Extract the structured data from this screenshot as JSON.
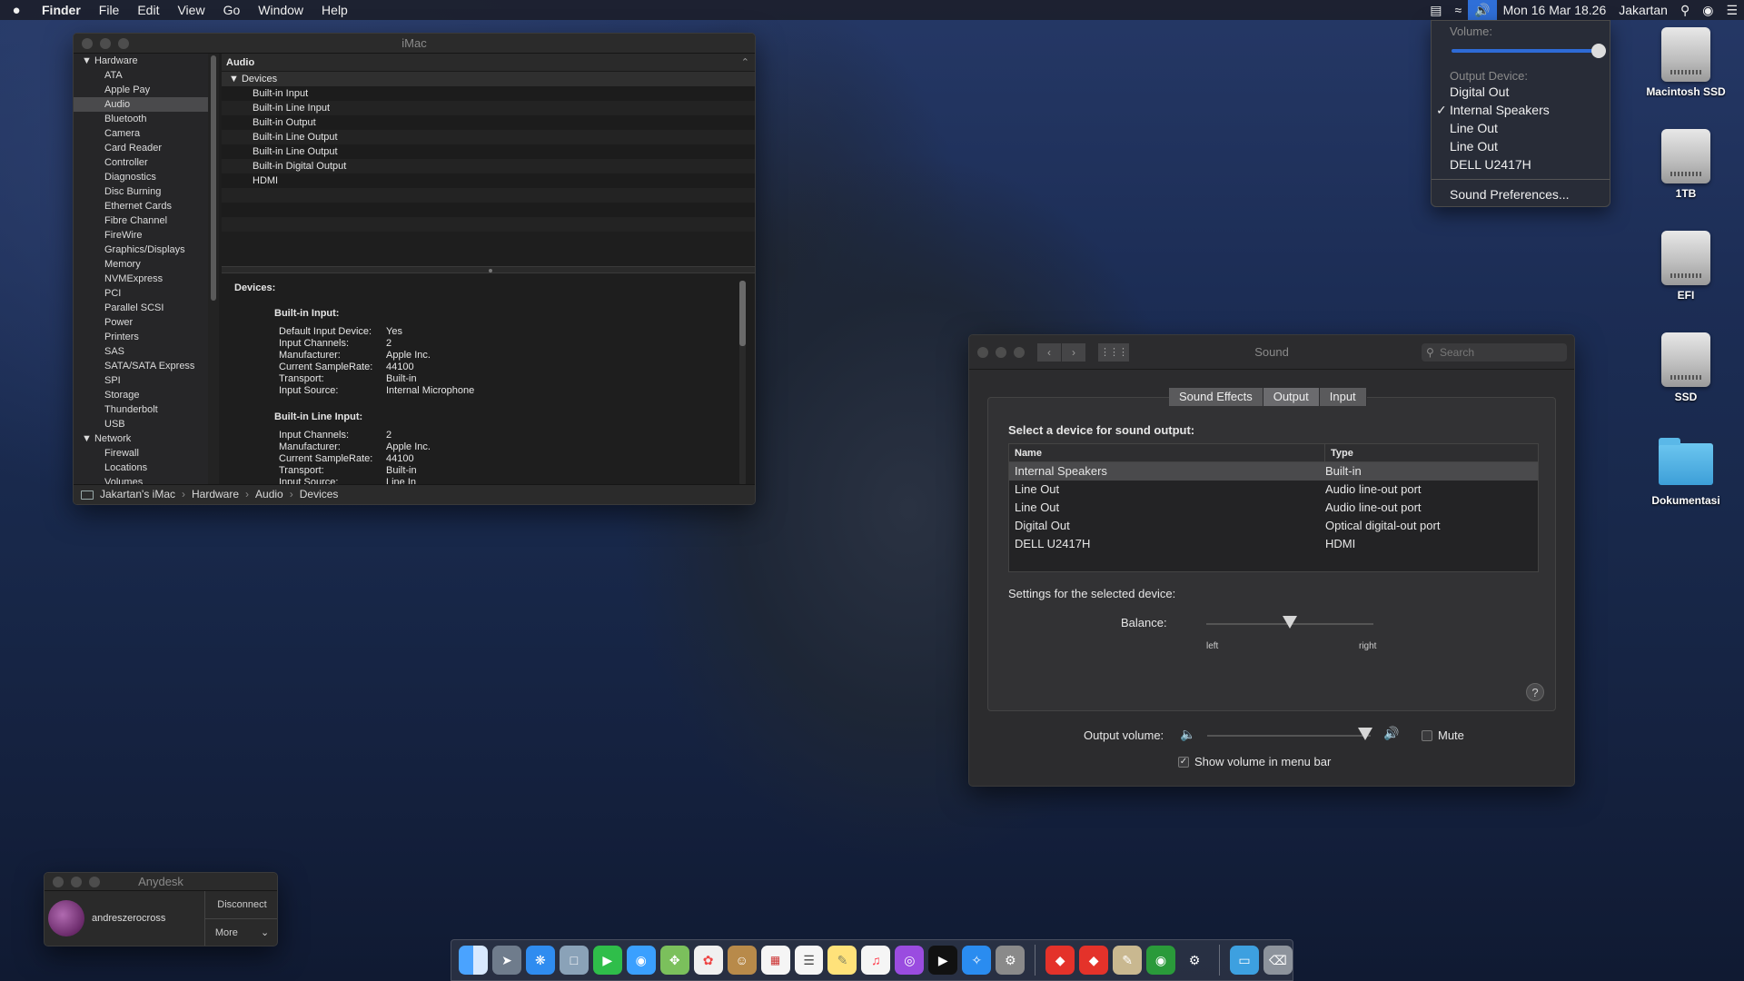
{
  "menubar": {
    "apple": "",
    "items": [
      "Finder",
      "File",
      "Edit",
      "View",
      "Go",
      "Window",
      "Help"
    ],
    "clock": "Mon 16 Mar 18.26",
    "user": "Jakartan"
  },
  "sysinfo": {
    "title": "iMac",
    "sidebar": {
      "hardware_label": "Hardware",
      "hardware_items": [
        "ATA",
        "Apple Pay",
        "Audio",
        "Bluetooth",
        "Camera",
        "Card Reader",
        "Controller",
        "Diagnostics",
        "Disc Burning",
        "Ethernet Cards",
        "Fibre Channel",
        "FireWire",
        "Graphics/Displays",
        "Memory",
        "NVMExpress",
        "PCI",
        "Parallel SCSI",
        "Power",
        "Printers",
        "SAS",
        "SATA/SATA Express",
        "SPI",
        "Storage",
        "Thunderbolt",
        "USB"
      ],
      "network_label": "Network",
      "network_items": [
        "Firewall",
        "Locations",
        "Volumes"
      ]
    },
    "header": "Audio",
    "devices_label": "Devices",
    "devices": [
      "Built-in Input",
      "Built-in Line Input",
      "Built-in Output",
      "Built-in Line Output",
      "Built-in Line Output",
      "Built-in Digital Output",
      "HDMI"
    ],
    "detail": {
      "heading": "Devices:",
      "sections": [
        {
          "title": "Built-in Input:",
          "rows": [
            {
              "k": "Default Input Device:",
              "v": "Yes"
            },
            {
              "k": "Input Channels:",
              "v": "2"
            },
            {
              "k": "Manufacturer:",
              "v": "Apple Inc."
            },
            {
              "k": "Current SampleRate:",
              "v": "44100"
            },
            {
              "k": "Transport:",
              "v": "Built-in"
            },
            {
              "k": "Input Source:",
              "v": "Internal Microphone"
            }
          ]
        },
        {
          "title": "Built-in Line Input:",
          "rows": [
            {
              "k": "Input Channels:",
              "v": "2"
            },
            {
              "k": "Manufacturer:",
              "v": "Apple Inc."
            },
            {
              "k": "Current SampleRate:",
              "v": "44100"
            },
            {
              "k": "Transport:",
              "v": "Built-in"
            },
            {
              "k": "Input Source:",
              "v": "Line In"
            }
          ]
        }
      ]
    },
    "path": [
      "Jakartan's iMac",
      "Hardware",
      "Audio",
      "Devices"
    ]
  },
  "volume_menu": {
    "volume_label": "Volume:",
    "volume_level": 1.0,
    "output_label": "Output Device:",
    "options": [
      "Digital Out",
      "Internal Speakers",
      "Line Out",
      "Line Out",
      "DELL U2417H"
    ],
    "checked_index": 1,
    "prefs": "Sound Preferences..."
  },
  "desktop_icons": [
    {
      "label": "Macintosh SSD",
      "type": "disk"
    },
    {
      "label": "1TB",
      "type": "disk"
    },
    {
      "label": "EFI",
      "type": "disk"
    },
    {
      "label": "SSD",
      "type": "disk"
    },
    {
      "label": "Dokumentasi",
      "type": "folder"
    }
  ],
  "sound": {
    "title": "Sound",
    "search_placeholder": "Search",
    "tabs": [
      "Sound Effects",
      "Output",
      "Input"
    ],
    "selected_tab": 1,
    "select_label": "Select a device for sound output:",
    "columns": [
      "Name",
      "Type"
    ],
    "devices": [
      {
        "name": "Internal Speakers",
        "type": "Built-in"
      },
      {
        "name": "Line Out",
        "type": "Audio line-out port"
      },
      {
        "name": "Line Out",
        "type": "Audio line-out port"
      },
      {
        "name": "Digital Out",
        "type": "Optical digital-out port"
      },
      {
        "name": "DELL U2417H",
        "type": "HDMI"
      }
    ],
    "settings_label": "Settings for the selected device:",
    "balance_label": "Balance:",
    "balance_left": "left",
    "balance_right": "right",
    "balance_value": 0.5,
    "help": "?",
    "output_volume_label": "Output volume:",
    "output_volume_value": 0.95,
    "mute_label": "Mute",
    "mute_checked": false,
    "show_volume_label": "Show volume in menu bar",
    "show_volume_checked": true
  },
  "anydesk": {
    "title": "Anydesk",
    "user": "andreszerocross",
    "disconnect": "Disconnect",
    "more": "More"
  }
}
